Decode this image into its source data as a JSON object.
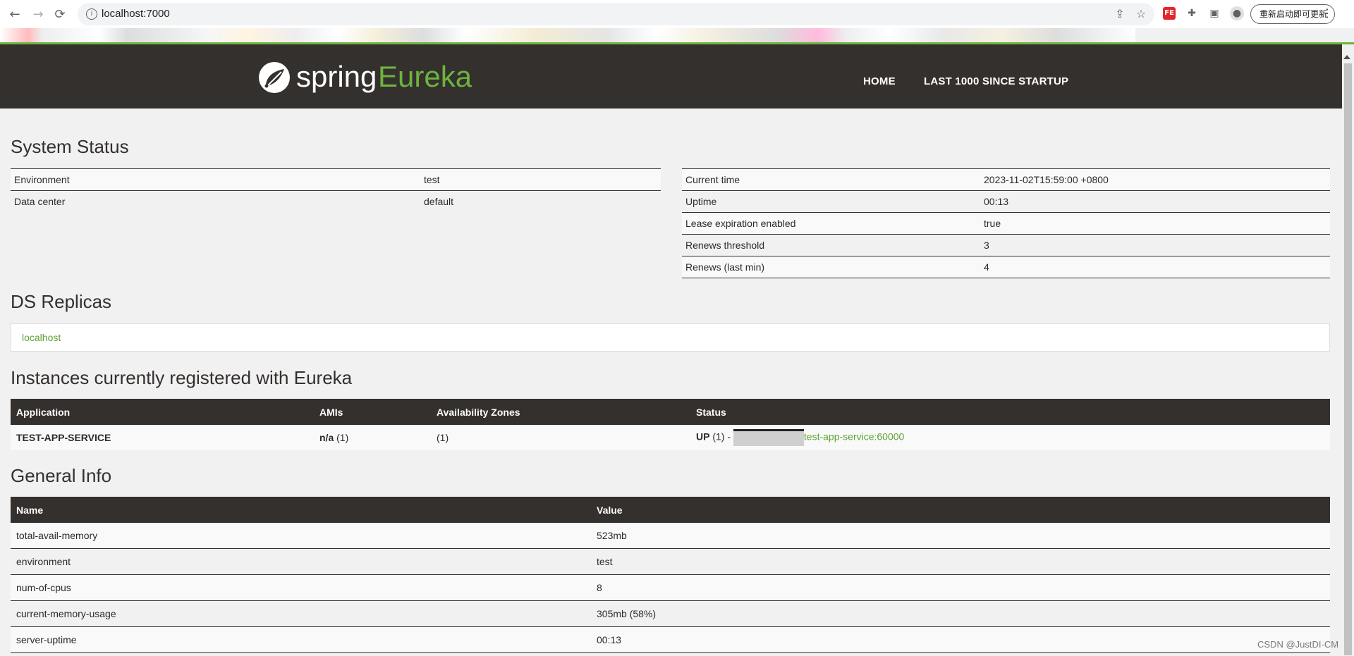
{
  "browser": {
    "url": "localhost:7000",
    "update_button": "重新启动即可更新",
    "back_icon": "arrow-left-icon",
    "forward_icon": "arrow-right-icon",
    "reload_icon": "reload-icon",
    "extensions": [
      "FE",
      "puzzle-icon",
      "sidebar-icon",
      "profile-icon"
    ]
  },
  "header": {
    "logo_word": "spring",
    "logo_product": "Eureka",
    "nav": [
      "HOME",
      "LAST 1000 SINCE STARTUP"
    ]
  },
  "colors": {
    "brand_green": "#6db33f",
    "header_bg": "#34302d",
    "link": "#5fa134"
  },
  "system_status": {
    "title": "System Status",
    "left": [
      {
        "label": "Environment",
        "value": "test"
      },
      {
        "label": "Data center",
        "value": "default"
      }
    ],
    "right": [
      {
        "label": "Current time",
        "value": "2023-11-02T15:59:00 +0800"
      },
      {
        "label": "Uptime",
        "value": "00:13"
      },
      {
        "label": "Lease expiration enabled",
        "value": "true"
      },
      {
        "label": "Renews threshold",
        "value": "3"
      },
      {
        "label": "Renews (last min)",
        "value": "4"
      }
    ]
  },
  "replicas": {
    "title": "DS Replicas",
    "items": [
      "localhost"
    ]
  },
  "instances": {
    "title": "Instances currently registered with Eureka",
    "headers": [
      "Application",
      "AMIs",
      "Availability Zones",
      "Status"
    ],
    "rows": [
      {
        "application": "TEST-APP-SERVICE",
        "amis_value": "n/a",
        "amis_count": "(1)",
        "zones": "(1)",
        "status": "UP",
        "status_count": "(1) -",
        "instance": "test-app-service:60000"
      }
    ]
  },
  "general_info": {
    "title": "General Info",
    "headers": [
      "Name",
      "Value"
    ],
    "rows": [
      {
        "name": "total-avail-memory",
        "value": "523mb"
      },
      {
        "name": "environment",
        "value": "test"
      },
      {
        "name": "num-of-cpus",
        "value": "8"
      },
      {
        "name": "current-memory-usage",
        "value": "305mb (58%)"
      },
      {
        "name": "server-uptime",
        "value": "00:13"
      }
    ]
  },
  "watermark": "CSDN @JustDI-CM"
}
